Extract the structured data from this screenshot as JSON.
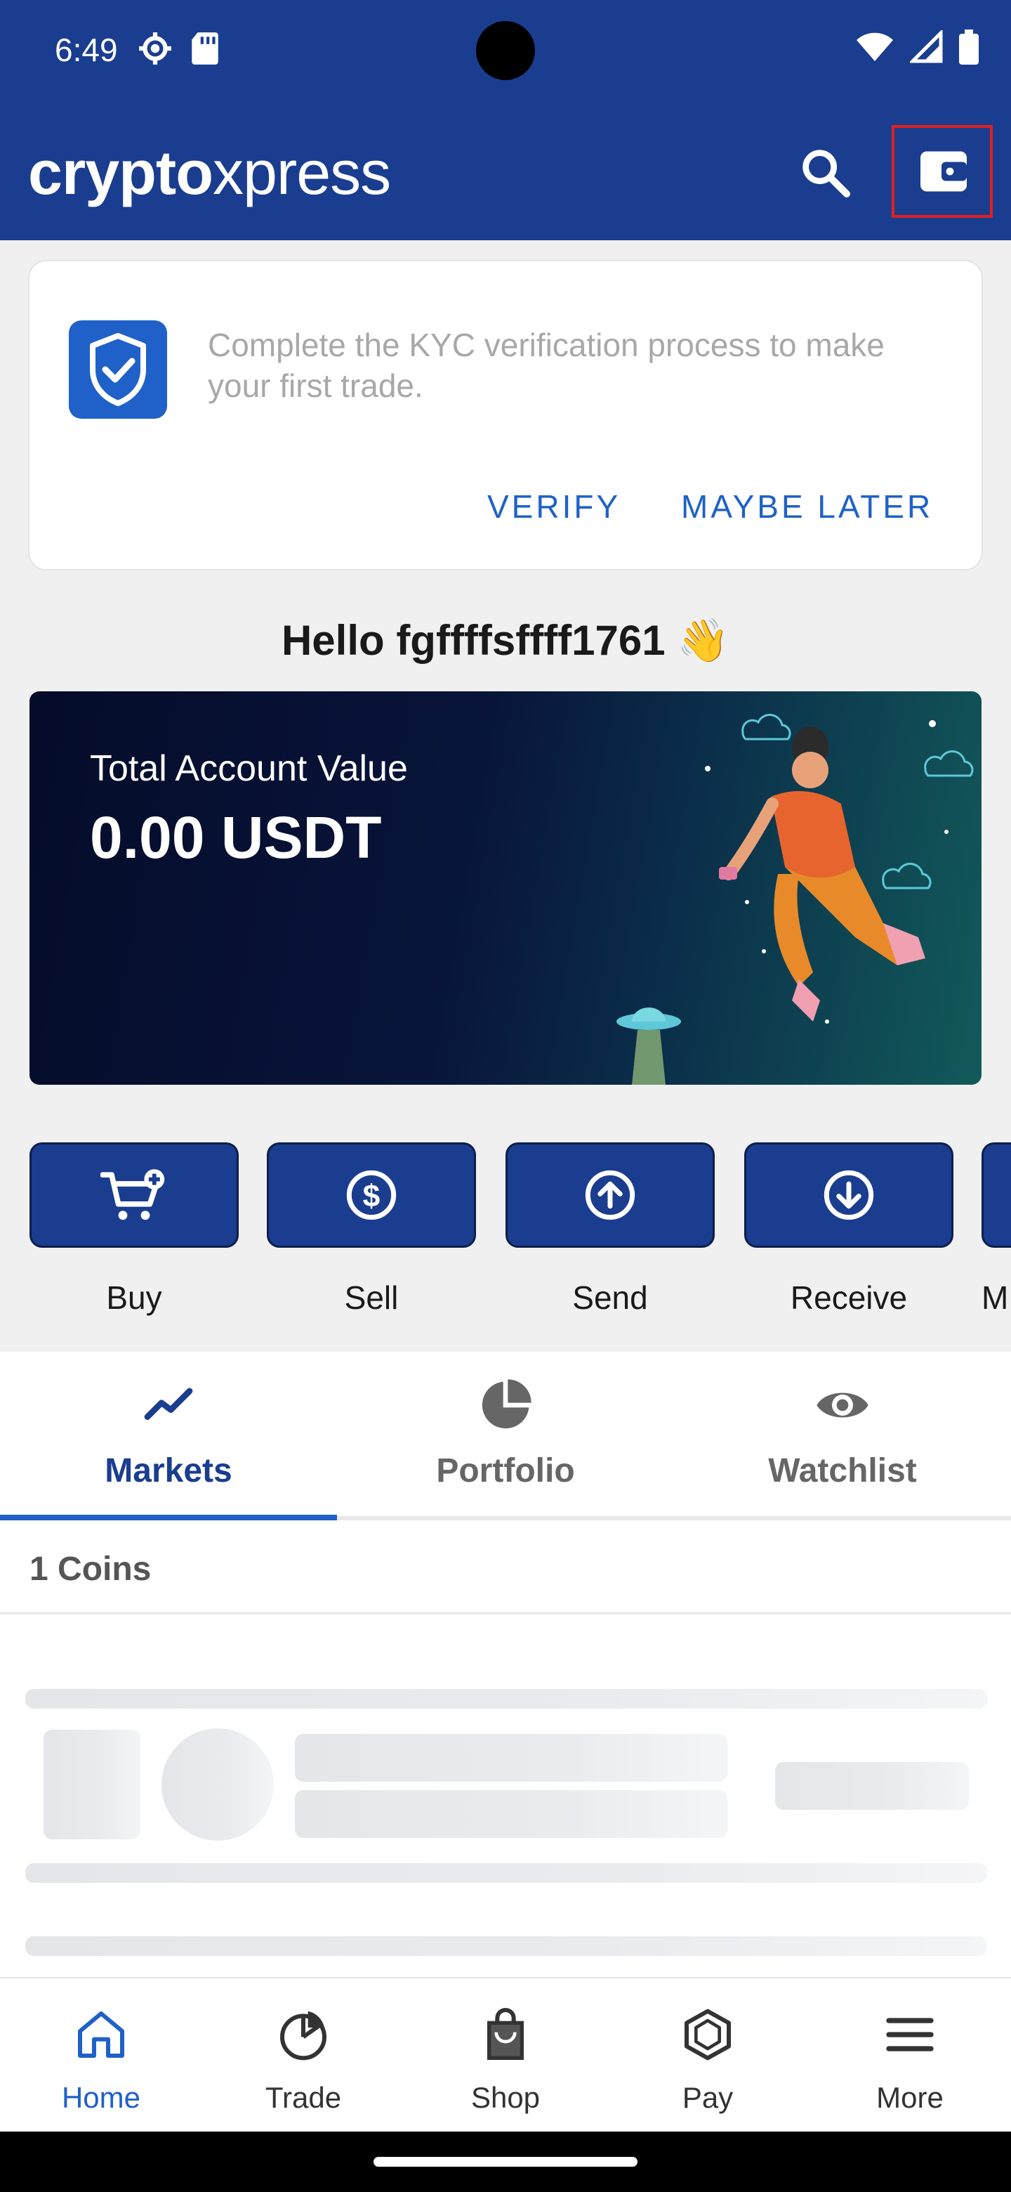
{
  "status_bar": {
    "time": "6:49"
  },
  "app": {
    "logo_bold": "crypto",
    "logo_light": "xpress"
  },
  "kyc": {
    "message": "Complete the KYC verification process to make your first trade.",
    "verify_label": "VERIFY",
    "later_label": "MAYBE LATER"
  },
  "greeting": "Hello fgffffsffff1761 👋",
  "account": {
    "label": "Total Account Value",
    "value": "0.00 USDT"
  },
  "quick_actions": [
    {
      "label": "Buy",
      "icon": "cart-plus-icon"
    },
    {
      "label": "Sell",
      "icon": "dollar-circle-icon"
    },
    {
      "label": "Send",
      "icon": "arrow-up-circle-icon"
    },
    {
      "label": "Receive",
      "icon": "arrow-down-circle-icon"
    },
    {
      "label": "M",
      "icon": "more-icon"
    }
  ],
  "tabs": [
    {
      "label": "Markets",
      "icon": "trend-line-icon",
      "active": true
    },
    {
      "label": "Portfolio",
      "icon": "pie-chart-icon",
      "active": false
    },
    {
      "label": "Watchlist",
      "icon": "eye-icon",
      "active": false
    }
  ],
  "coins_count": "1 Coins",
  "bottom_nav": [
    {
      "label": "Home",
      "icon": "home-icon",
      "active": true
    },
    {
      "label": "Trade",
      "icon": "trade-chart-icon",
      "active": false
    },
    {
      "label": "Shop",
      "icon": "shopping-bag-icon",
      "active": false
    },
    {
      "label": "Pay",
      "icon": "hexagon-icon",
      "active": false
    },
    {
      "label": "More",
      "icon": "menu-icon",
      "active": false
    }
  ],
  "colors": {
    "header": "#1a3d8f",
    "accent": "#1f61c9",
    "inactive_tab": "#666666"
  }
}
